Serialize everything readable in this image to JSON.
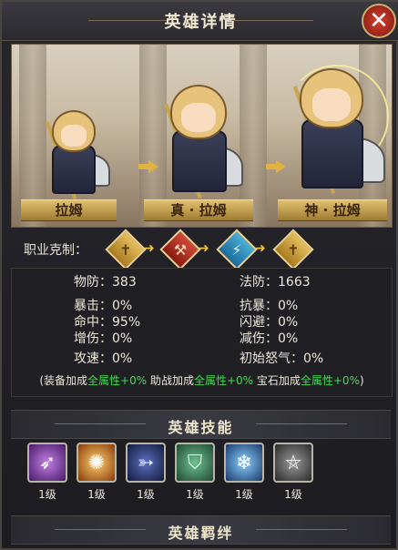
{
  "title": "英雄详情",
  "close_label": "✕",
  "heroes": [
    {
      "name": "拉姆"
    },
    {
      "name": "真 · 拉姆"
    },
    {
      "name": "神 · 拉姆"
    }
  ],
  "class_counter": {
    "label": "职业克制：",
    "chain": [
      "sword-class-icon",
      "axe-class-icon",
      "wand-class-icon",
      "sword-class-icon"
    ]
  },
  "stats": {
    "physical_def": "物防：383",
    "magic_def": "法防：1663",
    "crit": "暴击：0%",
    "crit_resist": "抗暴：0%",
    "hit": "命中：95%",
    "dodge": "闪避：0%",
    "dmg_up": "增伤：0%",
    "dmg_down": "减伤：0%",
    "atk_speed": "攻速：0%",
    "initial_rage": "初始怒气：0%"
  },
  "bonus": {
    "open": "(",
    "equip": "装备加成",
    "equip_val": "全属性+0%",
    "assist": " 助战加成",
    "assist_val": "全属性+0%",
    "gem": " 宝石加成",
    "gem_val": "全属性+0%",
    "close": ")"
  },
  "skills_title": "英雄技能",
  "skills": [
    {
      "level": "1级",
      "icon": "claw-slash-icon",
      "color": "#6a2a8a"
    },
    {
      "level": "1级",
      "icon": "fire-burst-icon",
      "color": "#b05a18"
    },
    {
      "level": "1级",
      "icon": "lightning-spear-icon",
      "color": "#2a3a6a"
    },
    {
      "level": "1级",
      "icon": "shield-icon",
      "color": "#2f6a4a"
    },
    {
      "level": "1级",
      "icon": "ice-crystal-icon",
      "color": "#2a4a7a"
    },
    {
      "level": "1级",
      "icon": "pentagram-icon",
      "color": "#4a4a4a"
    }
  ],
  "bonds_title": "英雄羁绊"
}
